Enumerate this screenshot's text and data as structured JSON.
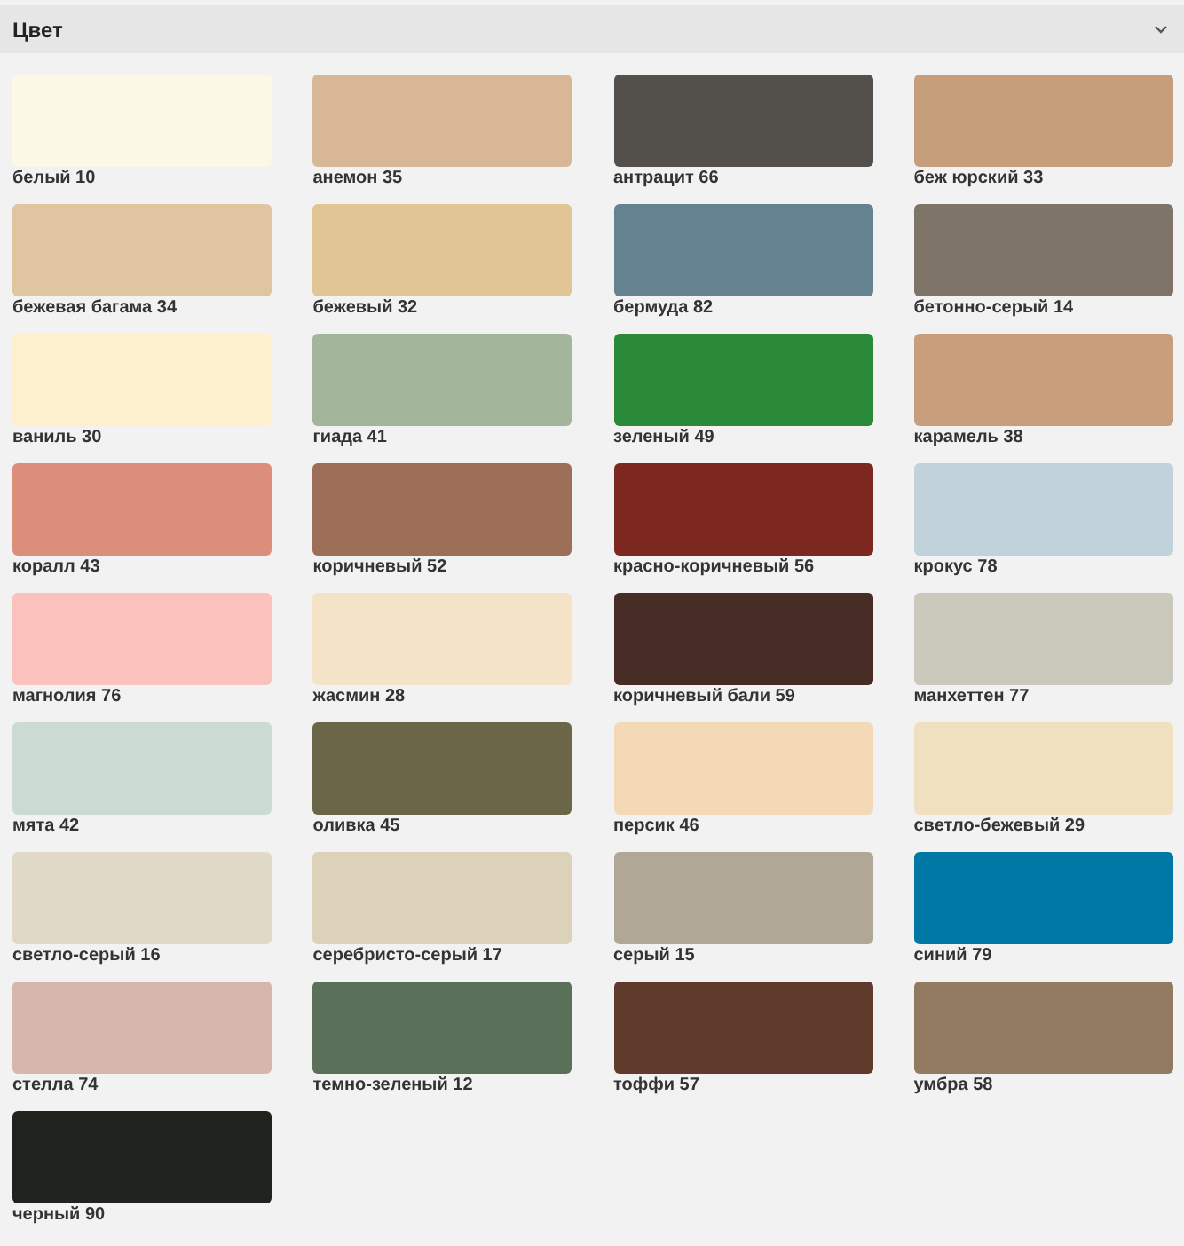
{
  "section": {
    "title": "Цвет",
    "expanded": true
  },
  "colors": [
    {
      "label": "белый 10",
      "color": "#fbf8e6"
    },
    {
      "label": "анемон 35",
      "color": "#d8b797"
    },
    {
      "label": "антрацит 66",
      "color": "#53504c"
    },
    {
      "label": "беж юрский 33",
      "color": "#c79e7b"
    },
    {
      "label": "бежевая багама 34",
      "color": "#dfc6a0"
    },
    {
      "label": "бежевый 32",
      "color": "#e1c595"
    },
    {
      "label": "бермуда 82",
      "color": "#64828f"
    },
    {
      "label": "бетонно-серый 14",
      "color": "#7e7568"
    },
    {
      "label": "ваниль 30",
      "color": "#fdf0cd"
    },
    {
      "label": "гиада 41",
      "color": "#a3b59b"
    },
    {
      "label": "зеленый 49",
      "color": "#2b8a37"
    },
    {
      "label": "карамель 38",
      "color": "#c99e7c"
    },
    {
      "label": "коралл 43",
      "color": "#dd8e7b"
    },
    {
      "label": "коричневый 52",
      "color": "#9d6f58"
    },
    {
      "label": "красно-коричневый 56",
      "color": "#7c2821"
    },
    {
      "label": "крокус 78",
      "color": "#c1d2da"
    },
    {
      "label": "магнолия 76",
      "color": "#fbc1bc"
    },
    {
      "label": "жасмин 28",
      "color": "#f4e3c6"
    },
    {
      "label": "коричневый бали 59",
      "color": "#472c25"
    },
    {
      "label": "манхеттен 77",
      "color": "#cbc8bc"
    },
    {
      "label": "мята 42",
      "color": "#cbdbd4"
    },
    {
      "label": "оливка 45",
      "color": "#6c6649"
    },
    {
      "label": "персик 46",
      "color": "#f4d9b7"
    },
    {
      "label": "светло-бежевый 29",
      "color": "#f1e0bf"
    },
    {
      "label": "светло-серый 16",
      "color": "#e0d9c8"
    },
    {
      "label": "серебристо-серый 17",
      "color": "#dcd2ba"
    },
    {
      "label": "серый 15",
      "color": "#b0a797"
    },
    {
      "label": "синий 79",
      "color": "#0078a5"
    },
    {
      "label": "стелла 74",
      "color": "#d7b6ae"
    },
    {
      "label": "темно-зеленый 12",
      "color": "#5a7058"
    },
    {
      "label": "тоффи 57",
      "color": "#603b2b"
    },
    {
      "label": "умбра 58",
      "color": "#917a5f"
    },
    {
      "label": "черный 90",
      "color": "#20221d"
    }
  ]
}
